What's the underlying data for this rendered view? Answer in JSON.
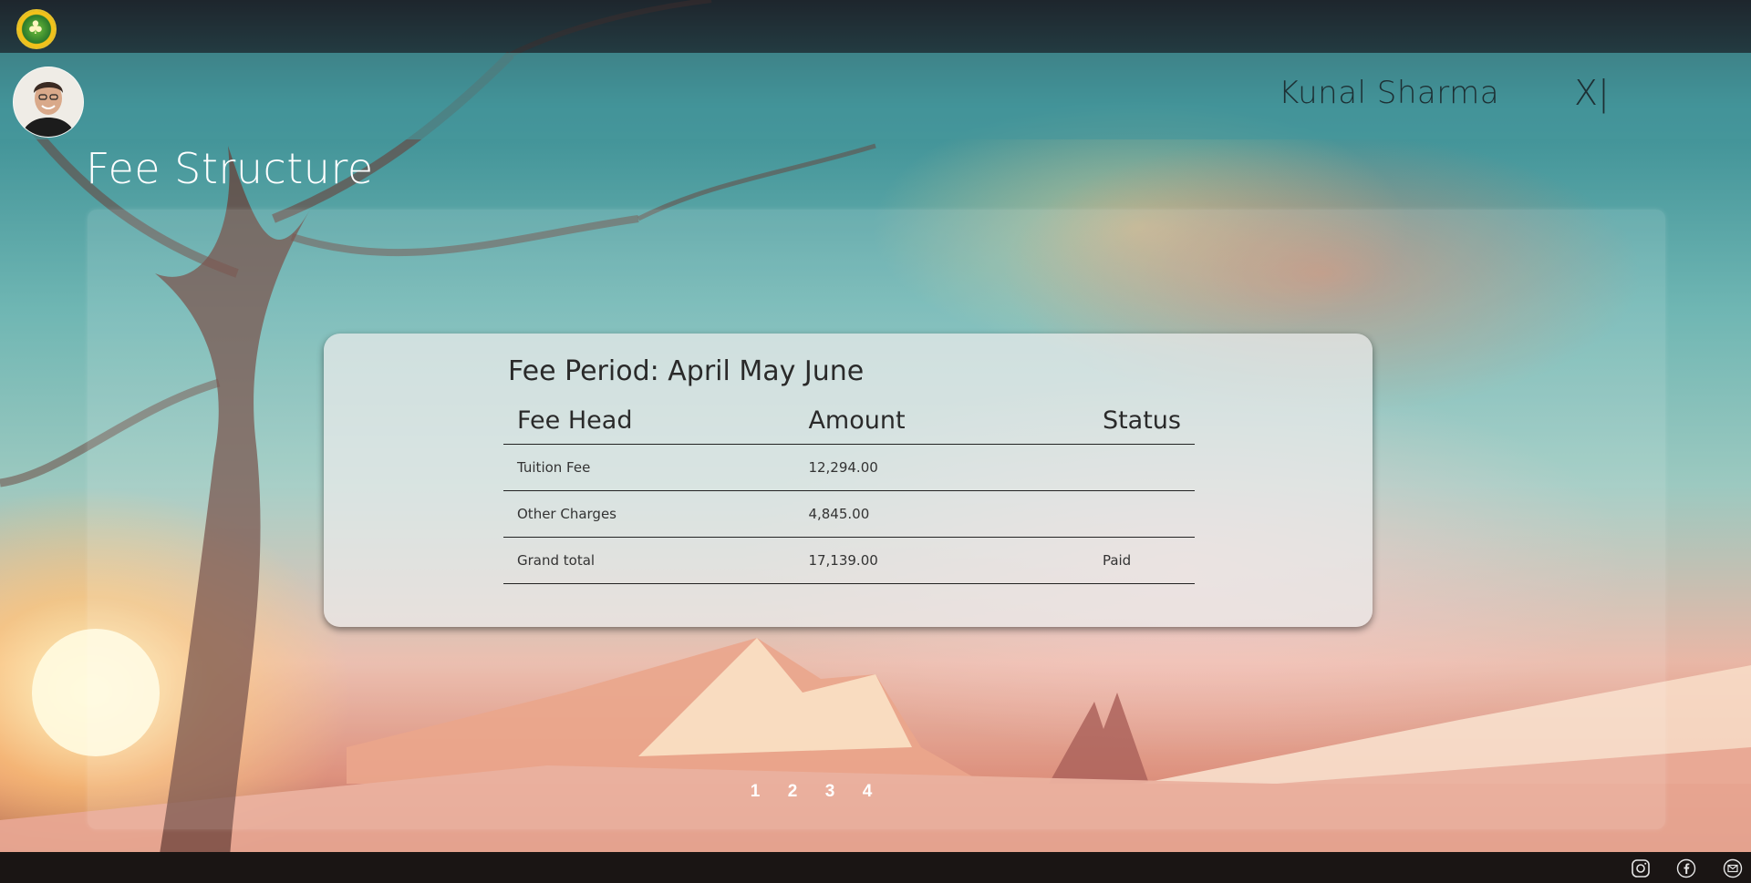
{
  "header": {
    "user_name": "Kunal Sharma",
    "close_label": "X|"
  },
  "page": {
    "title": "Fee Structure"
  },
  "fee_card": {
    "period_label": "Fee Period: April May June",
    "columns": [
      "Fee Head",
      "Amount",
      "Status"
    ],
    "rows": [
      {
        "head": "Tuition Fee",
        "amount": "12,294.00",
        "status": ""
      },
      {
        "head": "Other Charges",
        "amount": "4,845.00",
        "status": ""
      },
      {
        "head": "Grand total",
        "amount": "17,139.00",
        "status": "Paid"
      }
    ]
  },
  "pagination": [
    "1",
    "2",
    "3",
    "4"
  ],
  "footer": {
    "icons": [
      "instagram-icon",
      "facebook-icon",
      "mail-icon"
    ]
  }
}
